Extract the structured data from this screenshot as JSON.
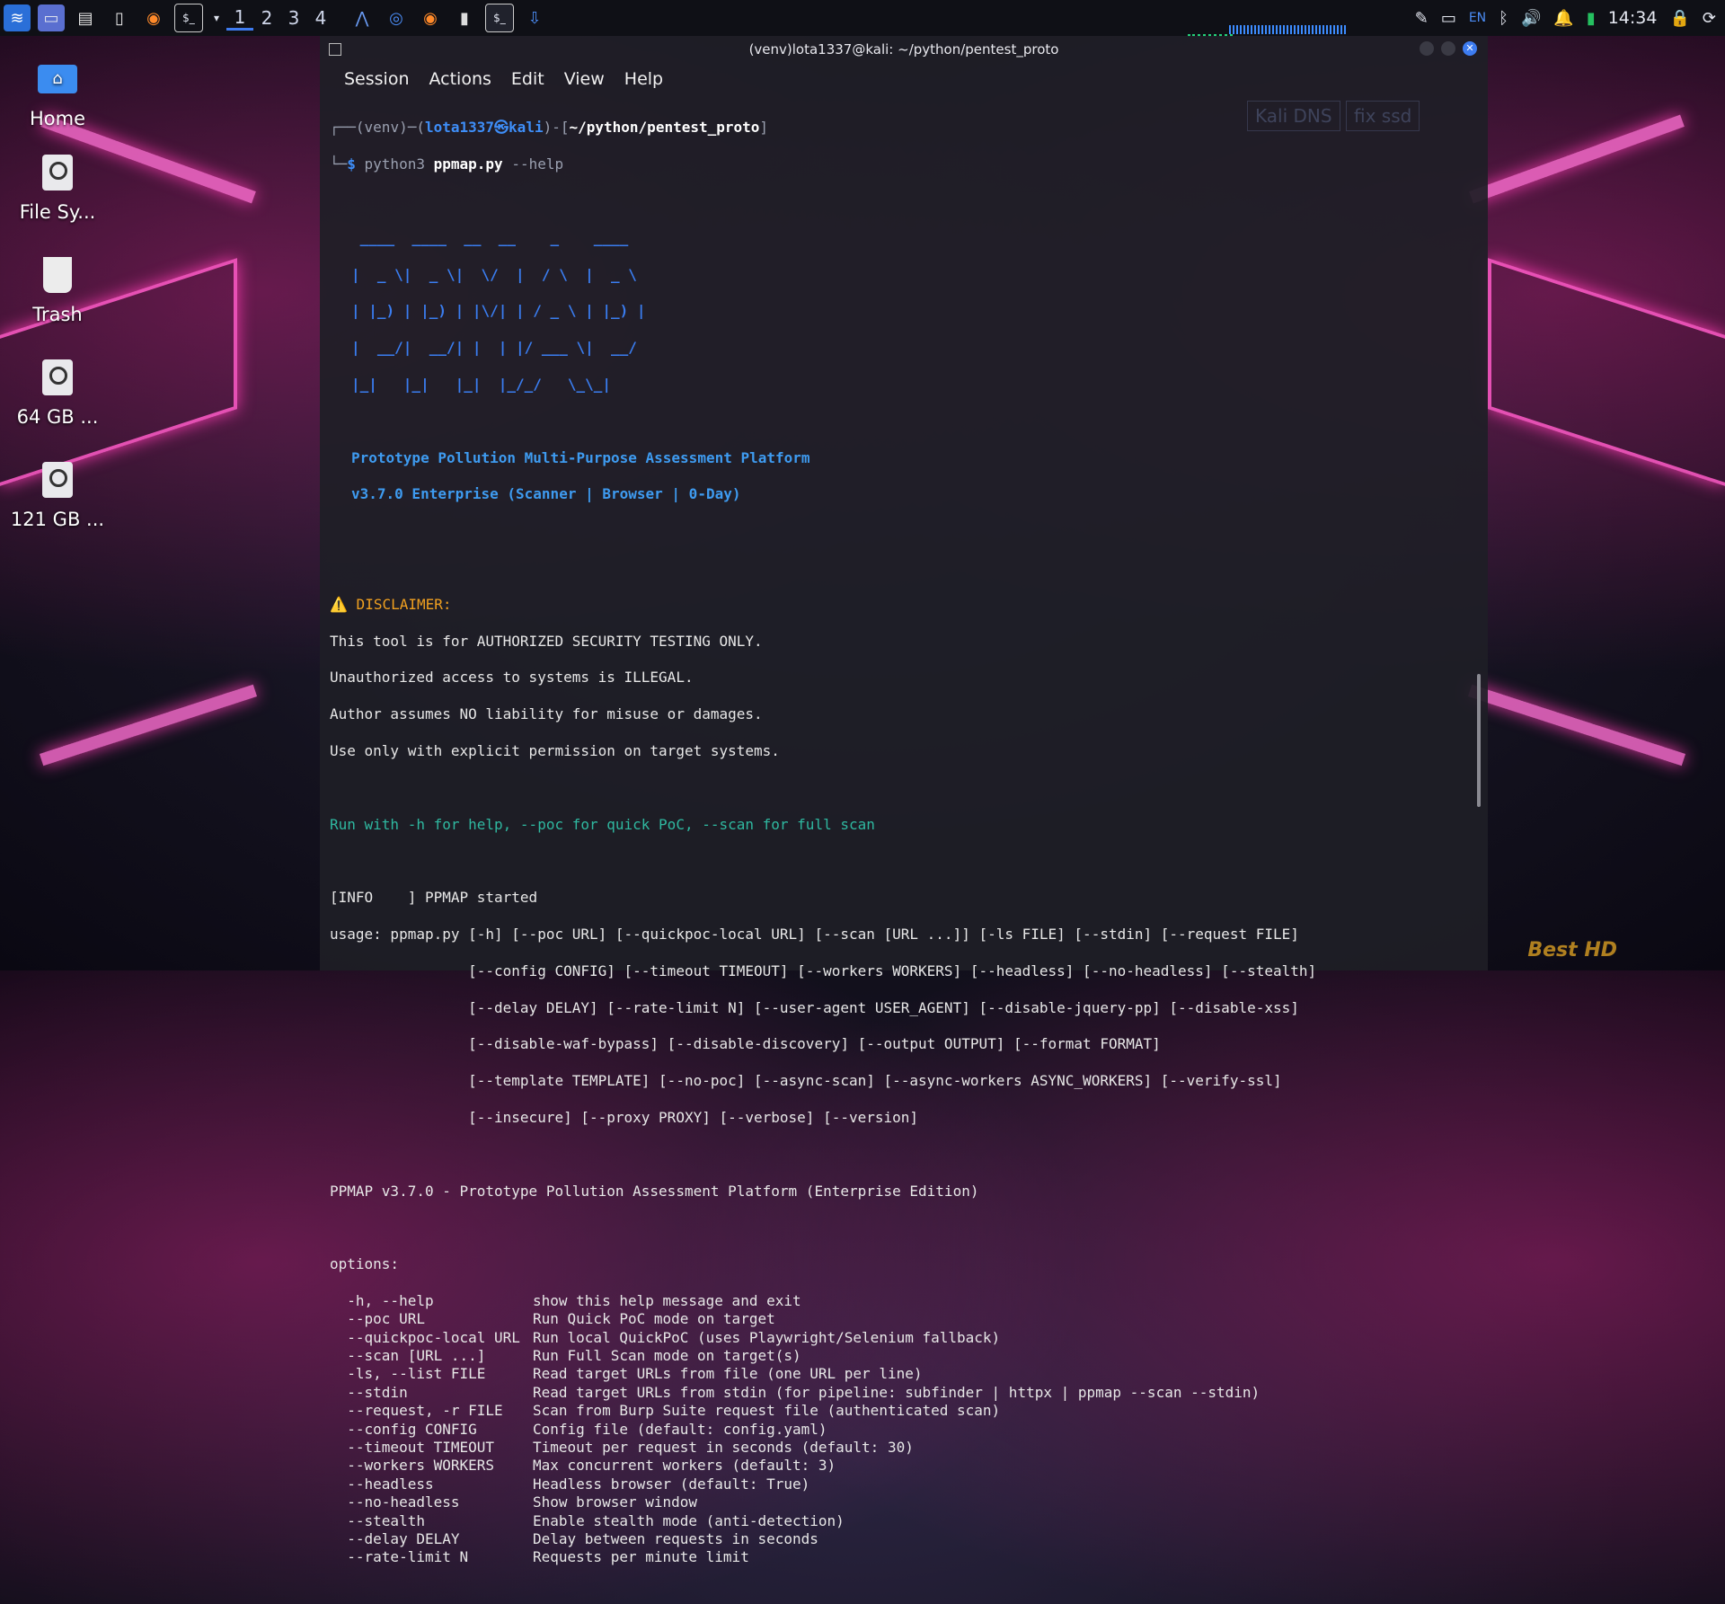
{
  "workspaces": [
    "1",
    "2",
    "3",
    "4"
  ],
  "tray": {
    "lang": "EN",
    "clock": "14:34"
  },
  "desktop_icons": [
    {
      "label": "Home"
    },
    {
      "label": "File Sy..."
    },
    {
      "label": "Trash"
    },
    {
      "label": "64 GB ..."
    },
    {
      "label": "121 GB ..."
    }
  ],
  "window": {
    "title": "(venv)lota1337@kali: ~/python/pentest_proto",
    "menu": [
      "Session",
      "Actions",
      "Edit",
      "View",
      "Help"
    ]
  },
  "overlay_labels": [
    "Kali DNS",
    "fix ssd"
  ],
  "terminal": {
    "prompt_venv": "(venv)",
    "prompt_user": "lota1337",
    "prompt_host": "kali",
    "prompt_path": "~/python/pentest_proto",
    "cmd_py": "python3",
    "cmd_file": "ppmap.py",
    "cmd_args": "--help",
    "ascii": [
      " ____  ____  __  __    _    ____",
      "|  _ \\|  _ \\|  \\/  |  / \\  |  _ \\",
      "| |_) | |_) | |\\/| | / _ \\ | |_) |",
      "|  __/|  __/| |  | |/ ___ \\|  __/",
      "|_|   |_|   |_|  |_/_/   \\_\\_|"
    ],
    "subtitle1": "Prototype Pollution Multi-Purpose Assessment Platform",
    "subtitle2": "v3.7.0 Enterprise (Scanner | Browser | 0-Day)",
    "disclaimer_title": "⚠️ DISCLAIMER:",
    "disclaimer": [
      "This tool is for AUTHORIZED SECURITY TESTING ONLY.",
      "Unauthorized access to systems is ILLEGAL.",
      "Author assumes NO liability for misuse or damages.",
      "Use only with explicit permission on target systems."
    ],
    "hint": "Run with -h for help, --poc for quick PoC, --scan for full scan",
    "info": "[INFO    ] PPMAP started",
    "usage": [
      "usage: ppmap.py [-h] [--poc URL] [--quickpoc-local URL] [--scan [URL ...]] [-ls FILE] [--stdin] [--request FILE]",
      "                [--config CONFIG] [--timeout TIMEOUT] [--workers WORKERS] [--headless] [--no-headless] [--stealth]",
      "                [--delay DELAY] [--rate-limit N] [--user-agent USER_AGENT] [--disable-jquery-pp] [--disable-xss]",
      "                [--disable-waf-bypass] [--disable-discovery] [--output OUTPUT] [--format FORMAT]",
      "                [--template TEMPLATE] [--no-poc] [--async-scan] [--async-workers ASYNC_WORKERS] [--verify-ssl]",
      "                [--insecure] [--proxy PROXY] [--verbose] [--version]"
    ],
    "description": "PPMAP v3.7.0 - Prototype Pollution Assessment Platform (Enterprise Edition)",
    "options_header": "options:",
    "options": [
      {
        "flag": "  -h, --help",
        "desc": "show this help message and exit"
      },
      {
        "flag": "  --poc URL",
        "desc": "Run Quick PoC mode on target"
      },
      {
        "flag": "  --quickpoc-local URL",
        "desc": "Run local QuickPoC (uses Playwright/Selenium fallback)"
      },
      {
        "flag": "  --scan [URL ...]",
        "desc": "Run Full Scan mode on target(s)"
      },
      {
        "flag": "  -ls, --list FILE",
        "desc": "Read target URLs from file (one URL per line)"
      },
      {
        "flag": "  --stdin",
        "desc": "Read target URLs from stdin (for pipeline: subfinder | httpx | ppmap --scan --stdin)"
      },
      {
        "flag": "  --request, -r FILE",
        "desc": "Scan from Burp Suite request file (authenticated scan)"
      },
      {
        "flag": "  --config CONFIG",
        "desc": "Config file (default: config.yaml)"
      },
      {
        "flag": "  --timeout TIMEOUT",
        "desc": "Timeout per request in seconds (default: 30)"
      },
      {
        "flag": "  --workers WORKERS",
        "desc": "Max concurrent workers (default: 3)"
      },
      {
        "flag": "  --headless",
        "desc": "Headless browser (default: True)"
      },
      {
        "flag": "  --no-headless",
        "desc": "Show browser window"
      },
      {
        "flag": "  --stealth",
        "desc": "Enable stealth mode (anti-detection)"
      },
      {
        "flag": "  --delay DELAY",
        "desc": "Delay between requests in seconds"
      },
      {
        "flag": "  --rate-limit N",
        "desc": "Requests per minute limit"
      }
    ]
  },
  "watermark": "Best HD"
}
